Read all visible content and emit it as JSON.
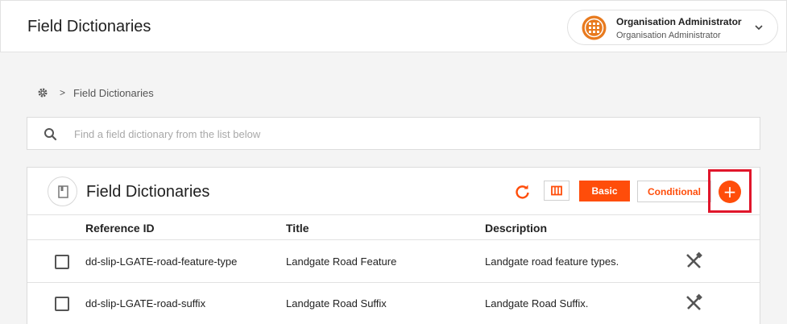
{
  "header": {
    "title": "Field Dictionaries",
    "user": {
      "name": "Organisation Administrator",
      "role": "Organisation Administrator"
    }
  },
  "breadcrumb": {
    "current": "Field Dictionaries",
    "separator": ">"
  },
  "search": {
    "placeholder": "Find a field dictionary from the list below",
    "value": ""
  },
  "panel": {
    "title": "Field Dictionaries",
    "buttons": {
      "basic": "Basic",
      "conditional": "Conditional",
      "add": "+"
    },
    "columns": [
      "Reference ID",
      "Title",
      "Description"
    ],
    "rows": [
      {
        "reference_id": "dd-slip-LGATE-road-feature-type",
        "title": "Landgate Road Feature",
        "description": "Landgate road feature types."
      },
      {
        "reference_id": "dd-slip-LGATE-road-suffix",
        "title": "Landgate Road Suffix",
        "description": "Landgate Road Suffix."
      }
    ]
  },
  "colors": {
    "accent": "#ff4d0a",
    "highlight": "#e0162b"
  }
}
